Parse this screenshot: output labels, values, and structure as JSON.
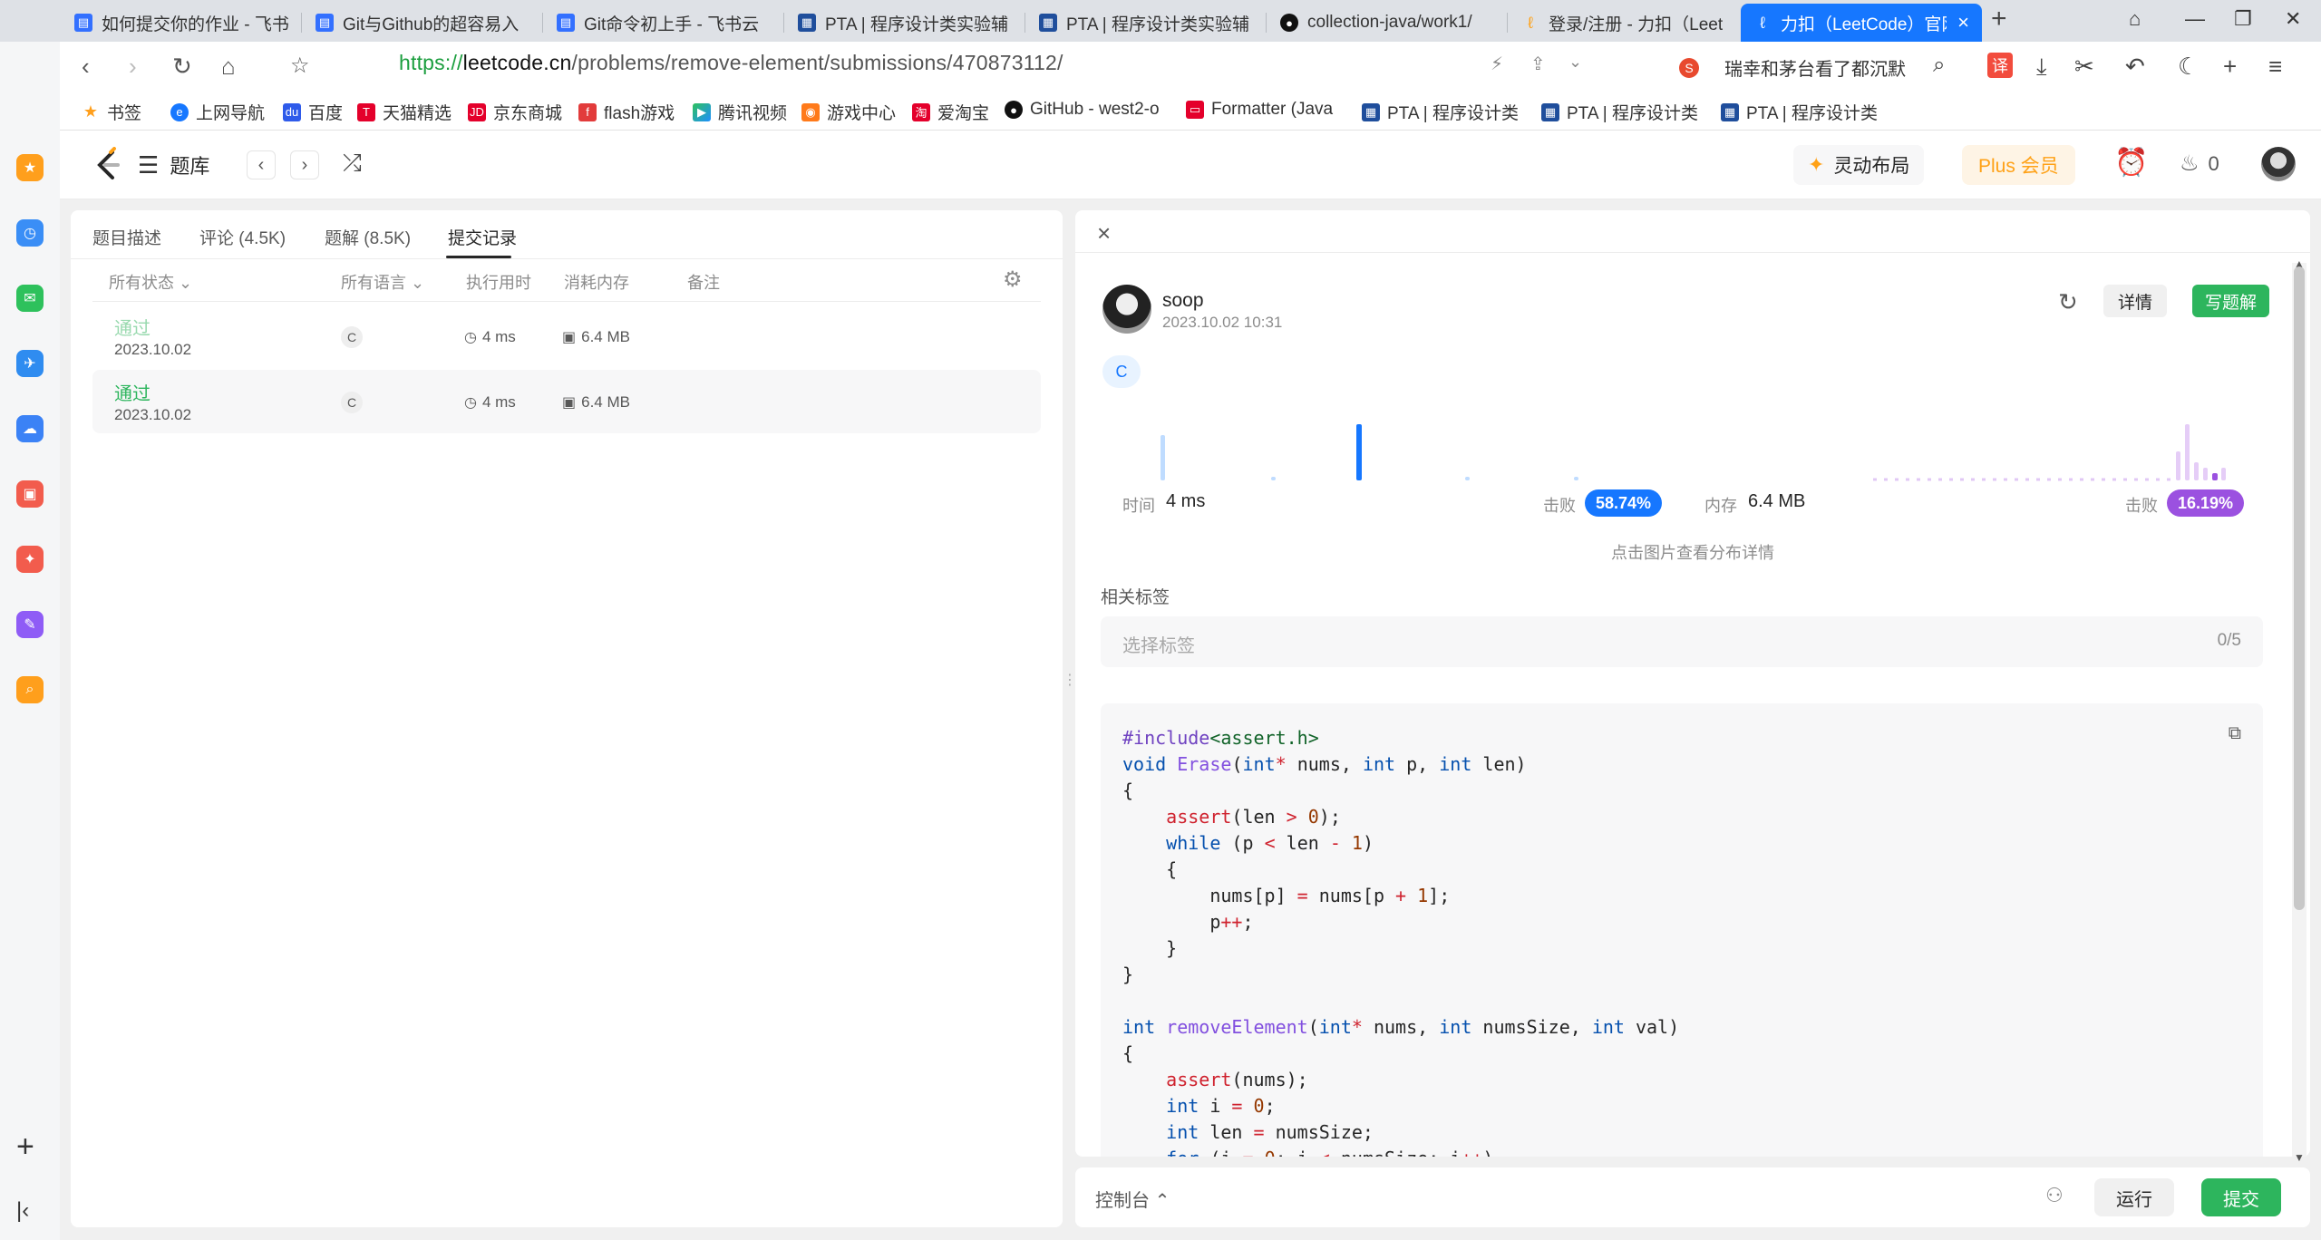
{
  "browser": {
    "tabs": [
      {
        "title": "如何提交你的作业 - 飞书",
        "icon_color": "#3370ff"
      },
      {
        "title": "Git与Github的超容易入",
        "icon_color": "#3370ff"
      },
      {
        "title": "Git命令初上手 - 飞书云",
        "icon_color": "#3370ff"
      },
      {
        "title": "PTA | 程序设计类实验辅",
        "icon_color": "#1f4e9c"
      },
      {
        "title": "PTA | 程序设计类实验辅",
        "icon_color": "#1f4e9c"
      },
      {
        "title": "collection-java/work1/",
        "icon_color": "#111111"
      },
      {
        "title": "登录/注册 - 力扣（Leet",
        "icon_color": "#ffa116"
      },
      {
        "title": "力扣（LeetCode）官网",
        "icon_color": "#ffffff",
        "active": true
      }
    ],
    "url": {
      "scheme": "https://",
      "host": "leetcode.cn",
      "path": "/problems/remove-element/submissions/470873112/"
    },
    "hot_search": "瑞幸和茅台看了都沉默",
    "translate_label": "译",
    "bookmarks": [
      "书签",
      "上网导航",
      "百度",
      "天猫精选",
      "京东商城",
      "flash游戏",
      "腾讯视频",
      "游戏中心",
      "爱淘宝",
      "GitHub - west2-o",
      "Formatter (Java",
      "PTA | 程序设计类",
      "PTA | 程序设计类",
      "PTA | 程序设计类"
    ]
  },
  "header": {
    "problems_label": "题库",
    "ling_layout": "灵动布局",
    "plus": "Plus 会员",
    "streak": "0"
  },
  "left_panel": {
    "tabs": [
      {
        "label": "题目描述"
      },
      {
        "label": "评论 (4.5K)"
      },
      {
        "label": "题解 (8.5K)"
      },
      {
        "label": "提交记录",
        "active": true
      }
    ],
    "columns": {
      "status": "所有状态",
      "lang": "所有语言",
      "runtime": "执行用时",
      "memory": "消耗内存",
      "note": "备注"
    },
    "rows": [
      {
        "status": "通过",
        "date": "2023.10.02",
        "lang": "C",
        "runtime": "4 ms",
        "memory": "6.4 MB",
        "status_color": "#98d9ae"
      },
      {
        "status": "通过",
        "date": "2023.10.02",
        "lang": "C",
        "runtime": "4 ms",
        "memory": "6.4 MB",
        "status_color": "#2db55d",
        "selected": true
      }
    ]
  },
  "right_panel": {
    "user": "soop",
    "submitted_at": "2023.10.02 10:31",
    "detail_btn": "详情",
    "write_btn": "写题解",
    "lang_badge": "C",
    "time_label": "时间",
    "time_value": "4 ms",
    "beat_label": "击败",
    "time_beat": "58.74%",
    "mem_label": "内存",
    "mem_value": "6.4 MB",
    "mem_beat": "16.19%",
    "hint": "点击图片查看分布详情",
    "tags_label": "相关标签",
    "tags_placeholder": "选择标签",
    "tags_count": "0/5",
    "colors": {
      "time_accent": "#1677ff",
      "mem_accent": "#9b51e0",
      "pass": "#2db55d"
    }
  },
  "console": {
    "label": "控制台",
    "run": "运行",
    "submit": "提交"
  }
}
